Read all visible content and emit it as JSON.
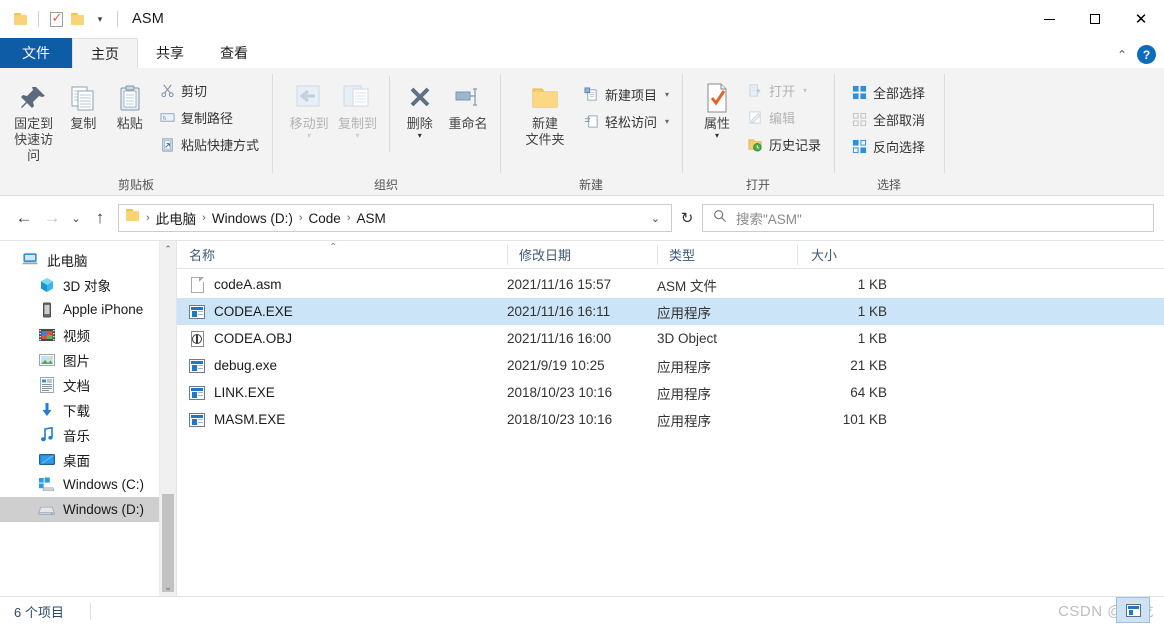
{
  "titlebar": {
    "title": "ASM",
    "qat": [
      {
        "name": "folder-icon",
        "label": ""
      },
      {
        "name": "properties-icon",
        "label": ""
      },
      {
        "name": "new-folder-icon",
        "label": ""
      },
      {
        "name": "customize-qat-chevron",
        "label": "▾"
      }
    ],
    "minimize": "—",
    "maximize": "□",
    "close": "✕"
  },
  "tabs": [
    {
      "id": "file",
      "label": "文件"
    },
    {
      "id": "home",
      "label": "主页"
    },
    {
      "id": "share",
      "label": "共享"
    },
    {
      "id": "view",
      "label": "查看"
    }
  ],
  "tab_right": {
    "collapse_chevron": "⌃",
    "help_label": "?"
  },
  "ribbon": {
    "groups": [
      {
        "name": "clipboard",
        "label": "剪贴板",
        "big_buttons": [
          {
            "name": "pin-to-quick-access",
            "icon": "pin-icon",
            "label": "固定到\n快速访问"
          },
          {
            "name": "copy",
            "icon": "copy-icon",
            "label": "复制"
          },
          {
            "name": "paste",
            "icon": "paste-icon",
            "label": "粘贴"
          }
        ],
        "small_buttons": [
          {
            "name": "cut",
            "icon": "scissors-icon",
            "label": "剪切",
            "dim": false
          },
          {
            "name": "copy-path",
            "icon": "copy-path-icon",
            "label": "复制路径",
            "dim": false
          },
          {
            "name": "paste-shortcut",
            "icon": "paste-shortcut-icon",
            "label": "粘贴快捷方式",
            "dim": false
          }
        ]
      },
      {
        "name": "organize",
        "label": "组织",
        "big_buttons": [
          {
            "name": "move-to",
            "icon": "move-to-icon",
            "label": "移动到",
            "caret": "▾",
            "dim": true
          },
          {
            "name": "copy-to",
            "icon": "copy-to-icon",
            "label": "复制到",
            "caret": "▾",
            "dim": true
          },
          {
            "name": "delete",
            "icon": "delete-x-icon",
            "label": "删除",
            "caret": "▾",
            "dim": false
          },
          {
            "name": "rename",
            "icon": "rename-icon",
            "label": "重命名",
            "dim": false
          }
        ],
        "small_buttons": []
      },
      {
        "name": "new",
        "label": "新建",
        "big_buttons": [
          {
            "name": "new-folder",
            "icon": "new-folder-icon",
            "label": "新建\n文件夹"
          }
        ],
        "small_buttons": [
          {
            "name": "new-item",
            "icon": "new-item-icon",
            "label": "新建项目",
            "caret": "▾",
            "dim": false
          },
          {
            "name": "easy-access",
            "icon": "easy-access-icon",
            "label": "轻松访问",
            "caret": "▾",
            "dim": false
          }
        ]
      },
      {
        "name": "open",
        "label": "打开",
        "big_buttons": [
          {
            "name": "properties",
            "icon": "properties-check-icon",
            "label": "属性",
            "caret": "▾"
          }
        ],
        "small_buttons": [
          {
            "name": "open",
            "icon": "open-icon",
            "label": "打开",
            "caret": "▾",
            "dim": true
          },
          {
            "name": "edit",
            "icon": "edit-icon",
            "label": "编辑",
            "dim": true
          },
          {
            "name": "history",
            "icon": "history-icon",
            "label": "历史记录",
            "dim": false
          }
        ]
      },
      {
        "name": "select",
        "label": "选择",
        "big_buttons": [],
        "small_buttons": [
          {
            "name": "select-all",
            "icon": "select-all-icon",
            "label": "全部选择",
            "dim": false
          },
          {
            "name": "select-none",
            "icon": "select-none-icon",
            "label": "全部取消",
            "dim": false
          },
          {
            "name": "invert-selection",
            "icon": "invert-selection-icon",
            "label": "反向选择",
            "dim": false
          }
        ]
      }
    ]
  },
  "addressbar": {
    "back": "←",
    "forward": "→",
    "recent_chevron": "⌄",
    "up": "↑",
    "breadcrumbs": [
      "此电脑",
      "Windows (D:)",
      "Code",
      "ASM"
    ],
    "separator": "›",
    "dropdown_chevron": "⌄",
    "refresh": "↻"
  },
  "search": {
    "icon": "search-icon",
    "placeholder": "搜索\"ASM\""
  },
  "sidebar": {
    "items": [
      {
        "name": "this-pc",
        "label": "此电脑",
        "icon": "computer-icon",
        "indent": 22,
        "selected": false
      },
      {
        "name": "3d-objects",
        "label": "3D 对象",
        "icon": "3d-object-icon",
        "indent": 38,
        "selected": false
      },
      {
        "name": "apple-iphone",
        "label": "Apple iPhone",
        "icon": "phone-icon",
        "indent": 38,
        "selected": false
      },
      {
        "name": "videos",
        "label": "视频",
        "icon": "videos-icon",
        "indent": 38,
        "selected": false
      },
      {
        "name": "pictures",
        "label": "图片",
        "icon": "pictures-icon",
        "indent": 38,
        "selected": false
      },
      {
        "name": "documents",
        "label": "文档",
        "icon": "documents-icon",
        "indent": 38,
        "selected": false
      },
      {
        "name": "downloads",
        "label": "下载",
        "icon": "downloads-icon",
        "indent": 38,
        "selected": false
      },
      {
        "name": "music",
        "label": "音乐",
        "icon": "music-icon",
        "indent": 38,
        "selected": false
      },
      {
        "name": "desktop",
        "label": "桌面",
        "icon": "desktop-icon",
        "indent": 38,
        "selected": false
      },
      {
        "name": "windows-c",
        "label": "Windows (C:)",
        "icon": "drive-windows-icon",
        "indent": 38,
        "selected": false
      },
      {
        "name": "windows-d",
        "label": "Windows (D:)",
        "icon": "drive-icon",
        "indent": 38,
        "selected": true
      }
    ],
    "scroll_up": "⌃",
    "scroll_down": "⌄"
  },
  "filelist": {
    "columns": [
      {
        "name": "name",
        "label": "名称",
        "sorted": true,
        "sort_mark": "⌃"
      },
      {
        "name": "date-modified",
        "label": "修改日期"
      },
      {
        "name": "type",
        "label": "类型"
      },
      {
        "name": "size",
        "label": "大小"
      }
    ],
    "rows": [
      {
        "name": "codeA.asm",
        "icon": "document-icon",
        "date": "2021/11/16 15:57",
        "type": "ASM 文件",
        "size": "1 KB",
        "selected": false
      },
      {
        "name": "CODEA.EXE",
        "icon": "application-icon",
        "date": "2021/11/16 16:11",
        "type": "应用程序",
        "size": "1 KB",
        "selected": true
      },
      {
        "name": "CODEA.OBJ",
        "icon": "3d-object-file-icon",
        "date": "2021/11/16 16:00",
        "type": "3D Object",
        "size": "1 KB",
        "selected": false
      },
      {
        "name": "debug.exe",
        "icon": "application-icon",
        "date": "2021/9/19 10:25",
        "type": "应用程序",
        "size": "21 KB",
        "selected": false
      },
      {
        "name": "LINK.EXE",
        "icon": "application-icon",
        "date": "2018/10/23 10:16",
        "type": "应用程序",
        "size": "64 KB",
        "selected": false
      },
      {
        "name": "MASM.EXE",
        "icon": "application-icon",
        "date": "2018/10/23 10:16",
        "type": "应用程序",
        "size": "101 KB",
        "selected": false
      }
    ]
  },
  "statusbar": {
    "item_count": "6 个项目"
  },
  "watermark": {
    "text": "CSDN @晓龙"
  },
  "colors": {
    "accent": "#0e5ba6",
    "selection": "#cce4f7",
    "sidebar_selection": "#cfcfcf",
    "ribbon_bg": "#f3f3f3",
    "header_text": "#3c5a78"
  }
}
